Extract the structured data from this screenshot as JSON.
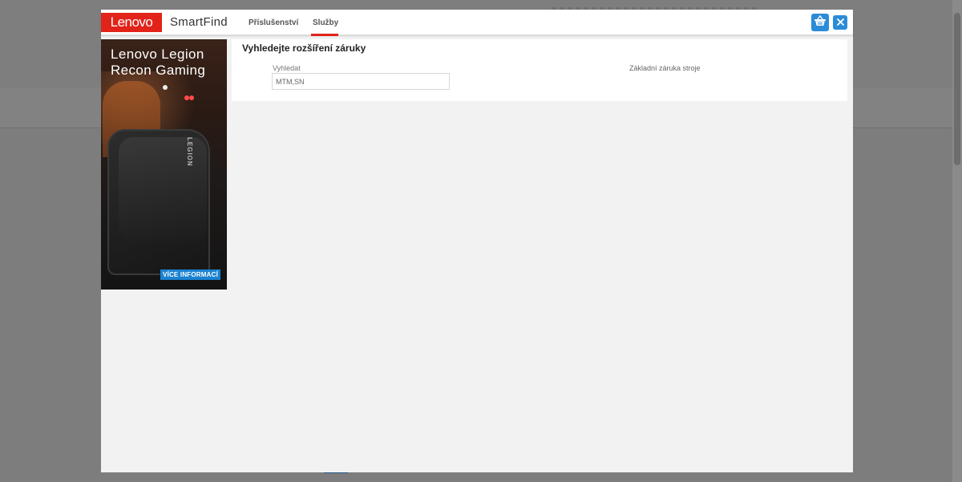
{
  "header": {
    "logo": "Lenovo",
    "brand": "SmartFind",
    "tabs": [
      {
        "label": "Příslušenství"
      },
      {
        "label": "Služby",
        "active": true
      }
    ]
  },
  "icons": {
    "cart": "shopping-basket-icon",
    "close": "close-icon"
  },
  "ad": {
    "title": "Lenovo Legion Recon Gaming",
    "bag_text": "LEGION",
    "cta": "VÍCE INFORMACÍ"
  },
  "search": {
    "title": "Vyhledejte rozšíření záruky",
    "label": "Vyhledat",
    "placeholder": "MTM,SN",
    "warranty_label": "Základní záruka stroje"
  },
  "colors": {
    "brand_red": "#e2231a",
    "accent_blue": "#2b8bd6",
    "cta_blue": "#1a82d1"
  }
}
